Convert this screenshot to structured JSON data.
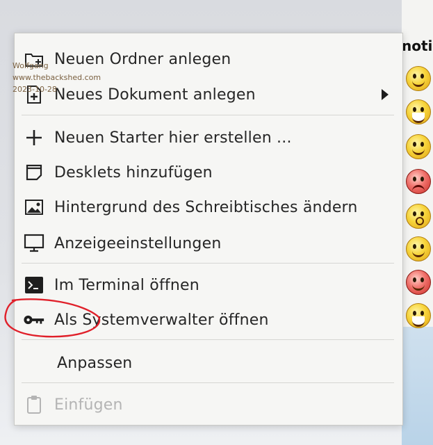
{
  "background": {
    "notice_text": "notic",
    "smileys": [
      "smiley",
      "laughing",
      "blush",
      "angry",
      "surprised",
      "grin",
      "red",
      "big-grin"
    ]
  },
  "watermark": {
    "author": "Wolfgang",
    "site": "www.thebackshed.com",
    "date": "2023-10-28"
  },
  "context_menu": {
    "items": [
      {
        "label": "Neuen Ordner anlegen",
        "icon": "folder-new-icon",
        "enabled": true,
        "has_submenu": false
      },
      {
        "label": "Neues Dokument anlegen",
        "icon": "document-new-icon",
        "enabled": true,
        "has_submenu": true
      },
      {
        "label": "Neuen Starter hier erstellen ...",
        "icon": "plus-icon",
        "enabled": true,
        "has_submenu": false
      },
      {
        "label": "Desklets hinzufügen",
        "icon": "desklet-icon",
        "enabled": true,
        "has_submenu": false
      },
      {
        "label": "Hintergrund des Schreibtisches ändern",
        "icon": "image-icon",
        "enabled": true,
        "has_submenu": false
      },
      {
        "label": "Anzeigeeinstellungen",
        "icon": "monitor-icon",
        "enabled": true,
        "has_submenu": false
      },
      {
        "label": "Im Terminal öffnen",
        "icon": "terminal-icon",
        "enabled": true,
        "has_submenu": false
      },
      {
        "label": "Als Systemverwalter öffnen",
        "icon": "key-icon",
        "enabled": true,
        "has_submenu": false
      },
      {
        "label": "Anpassen",
        "icon": "",
        "enabled": true,
        "has_submenu": false
      },
      {
        "label": "Einfügen",
        "icon": "clipboard-icon",
        "enabled": false,
        "has_submenu": false
      }
    ]
  },
  "colors": {
    "menu_bg": "#f6f6f4",
    "text": "#262626",
    "disabled_text": "#b4b4b4",
    "annotation_red": "#e0202a"
  }
}
